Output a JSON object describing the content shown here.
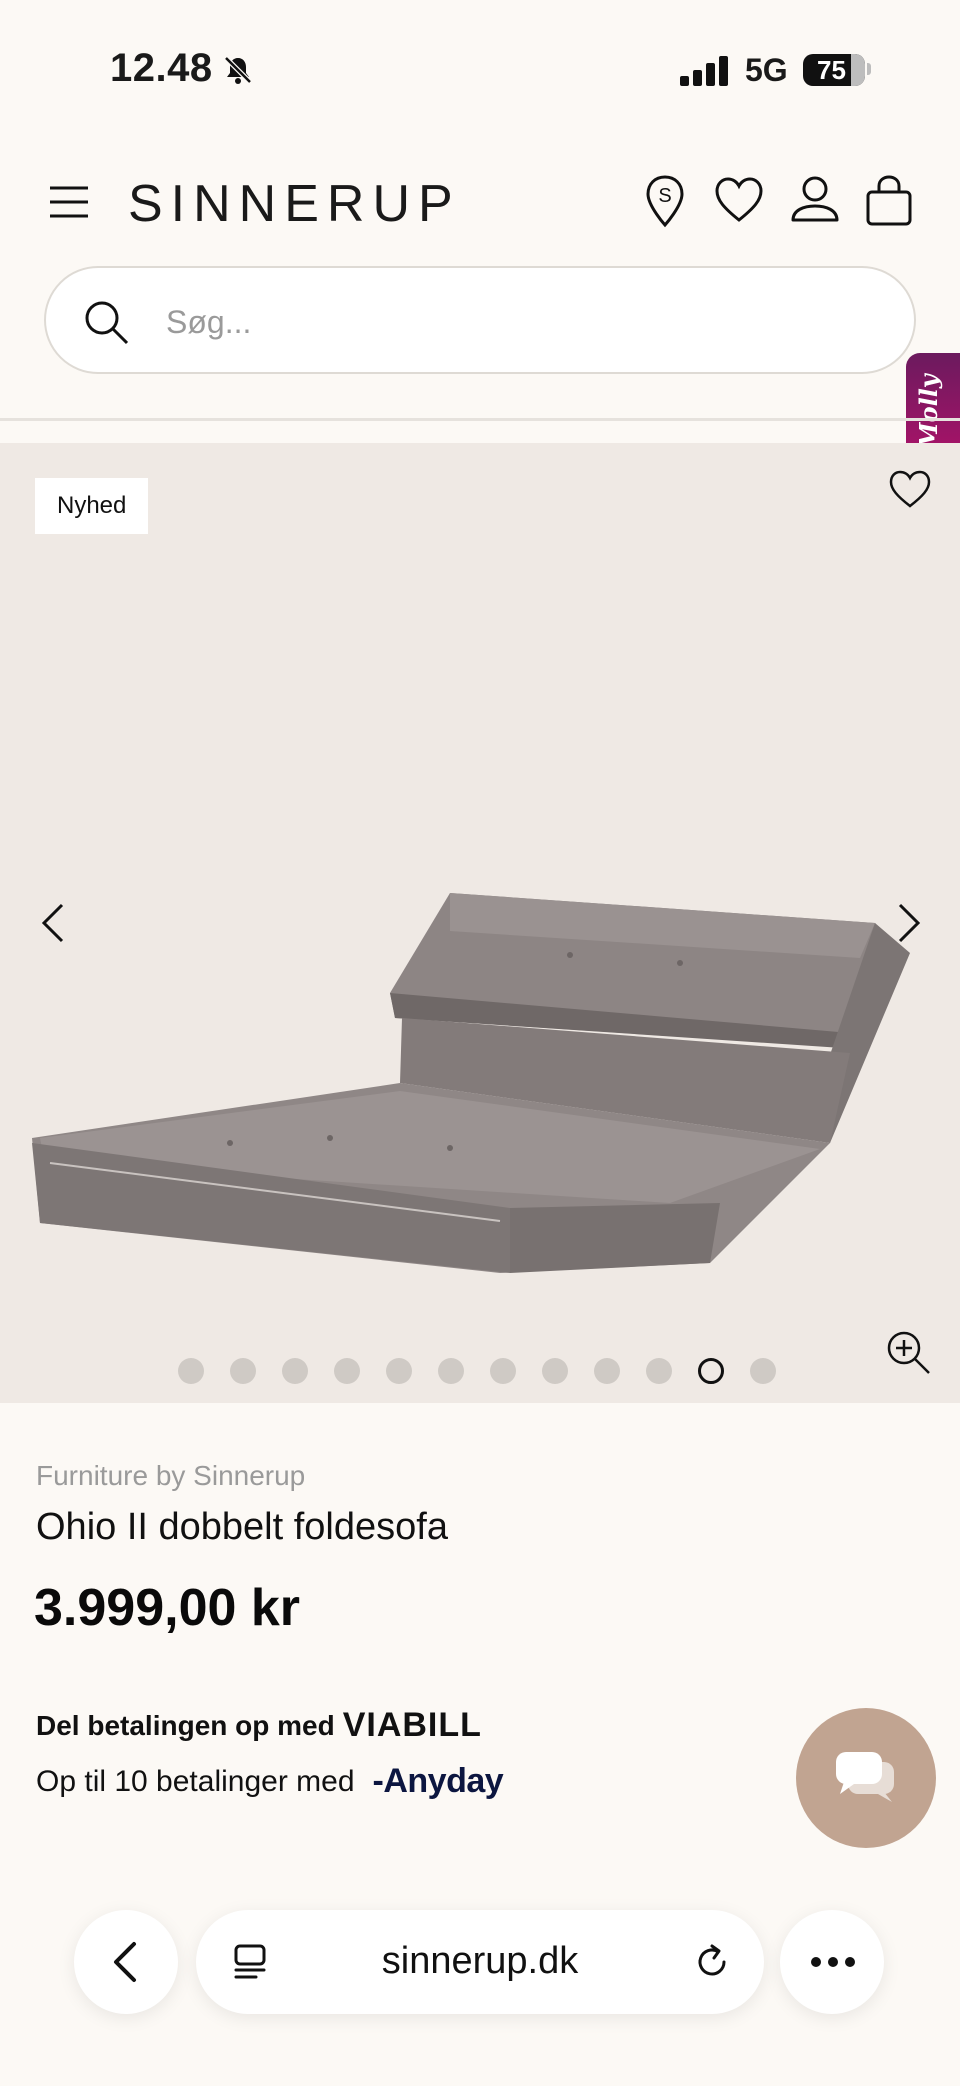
{
  "status_bar": {
    "time": "12.48",
    "network": "5G",
    "battery": "75"
  },
  "header": {
    "logo": "SINNERUP",
    "icons": [
      "menu-icon",
      "store-location-icon",
      "wishlist-icon",
      "account-icon",
      "cart-icon"
    ]
  },
  "search": {
    "placeholder": "Søg...",
    "value": ""
  },
  "molly": {
    "label": "Molly"
  },
  "gallery": {
    "badge": "Nyhed",
    "dot_count": 12,
    "active_dot": 11
  },
  "product": {
    "brand": "Furniture by Sinnerup",
    "title": "Ohio II dobbelt foldesofa",
    "price": "3.999,00 kr"
  },
  "payment": {
    "viabill_text": "Del betalingen op med",
    "viabill_logo": "VIABILL",
    "anyday_text": "Op til 10 betalinger med",
    "anyday_logo": "-Anyday"
  },
  "browser": {
    "url": "sinnerup.dk"
  },
  "colors": {
    "background": "#fcf9f5",
    "gallery_bg": "#efe9e4",
    "chat_button": "#c1a491",
    "molly_tab": "#9b1466"
  }
}
